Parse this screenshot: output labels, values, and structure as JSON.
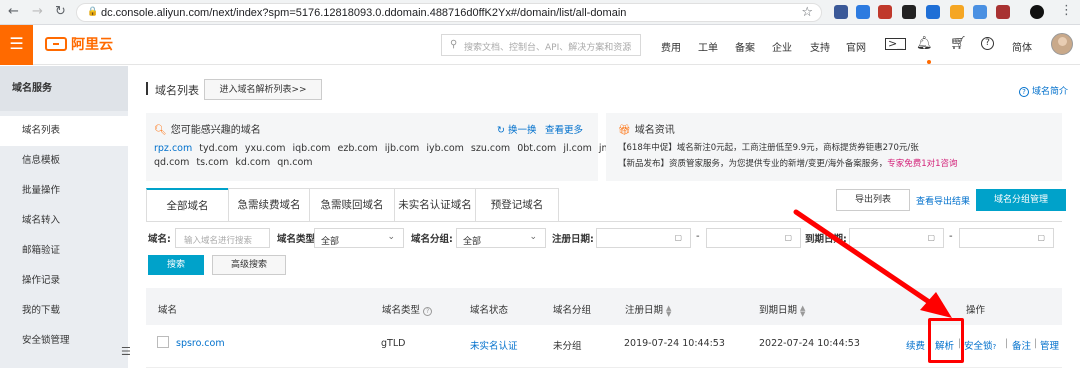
{
  "browser": {
    "url": "dc.console.aliyun.com/next/index?spm=5176.12818093.0.ddomain.488716d0ffK2Yx#/domain/list/all-domain"
  },
  "header": {
    "logo_text": "阿里云",
    "search_placeholder": "搜索文档、控制台、API、解决方案和资源",
    "nav": [
      "费用",
      "工单",
      "备案",
      "企业",
      "支持",
      "官网"
    ],
    "language": "简体"
  },
  "sidebar": {
    "title": "域名服务",
    "items": [
      {
        "label": "域名列表",
        "active": true
      },
      {
        "label": "信息模板"
      },
      {
        "label": "批量操作"
      },
      {
        "label": "域名转入"
      },
      {
        "label": "邮箱验证"
      },
      {
        "label": "操作记录"
      },
      {
        "label": "我的下载"
      },
      {
        "label": "安全锁管理"
      }
    ]
  },
  "page": {
    "title": "域名列表",
    "goto_dns_button": "进入域名解析列表>>",
    "intro_link": "域名简介"
  },
  "interest": {
    "title": "您可能感兴趣的域名",
    "refresh": "换一换",
    "more": "查看更多",
    "row1": [
      "rpz.com",
      "tyd.com",
      "yxu.com",
      "iqb.com",
      "ezb.com",
      "ijb.com",
      "iyb.com",
      "szu.com",
      "0bt.com",
      "jl.com",
      "jn.com"
    ],
    "row2": [
      "qd.com",
      "ts.com",
      "kd.com",
      "qn.com"
    ]
  },
  "news": {
    "title": "域名资讯",
    "line1": "【618年中促】域名新注0元起，工商注册低至9.9元，商标提货券钜惠270元/张",
    "line2_prefix": "【新品发布】资质管家服务，为您提供专业的新增/变更/海外备案服务，",
    "line2_highlight": "专家免费1对1咨询"
  },
  "tabs": [
    "全部域名",
    "急需续费域名",
    "急需赎回域名",
    "未实名认证域名",
    "预登记域名"
  ],
  "actions": {
    "export": "导出列表",
    "view_export": "查看导出结果",
    "group_manage": "域名分组管理"
  },
  "filters": {
    "domain_label": "域名:",
    "domain_placeholder": "输入域名进行搜索",
    "type_label": "域名类型:",
    "type_value": "全部",
    "group_label": "域名分组:",
    "group_value": "全部",
    "reg_date_label": "注册日期:",
    "expire_date_label": "到期日期:",
    "range_sep": "-",
    "search_button": "搜索",
    "advanced_button": "高级搜索"
  },
  "table": {
    "headers": {
      "name": "域名",
      "type": "域名类型",
      "status": "域名状态",
      "group": "域名分组",
      "reg": "注册日期",
      "exp": "到期日期",
      "ops": "操作"
    },
    "row": {
      "name": "spsro.com",
      "type": "gTLD",
      "status": "未实名认证",
      "group": "未分组",
      "reg": "2019-07-24 10:44:53",
      "exp": "2022-07-24 10:44:53",
      "ops": {
        "renew": "续费",
        "resolve": "解析",
        "lock": "安全锁",
        "note": "备注",
        "manage": "管理",
        "sep": "|"
      }
    }
  },
  "colors": {
    "brand": "#ff6a00",
    "primary": "#00a2ca",
    "link": "#0070cc",
    "highlight_red": "#ff0000",
    "news_highlight": "#d4237a"
  }
}
